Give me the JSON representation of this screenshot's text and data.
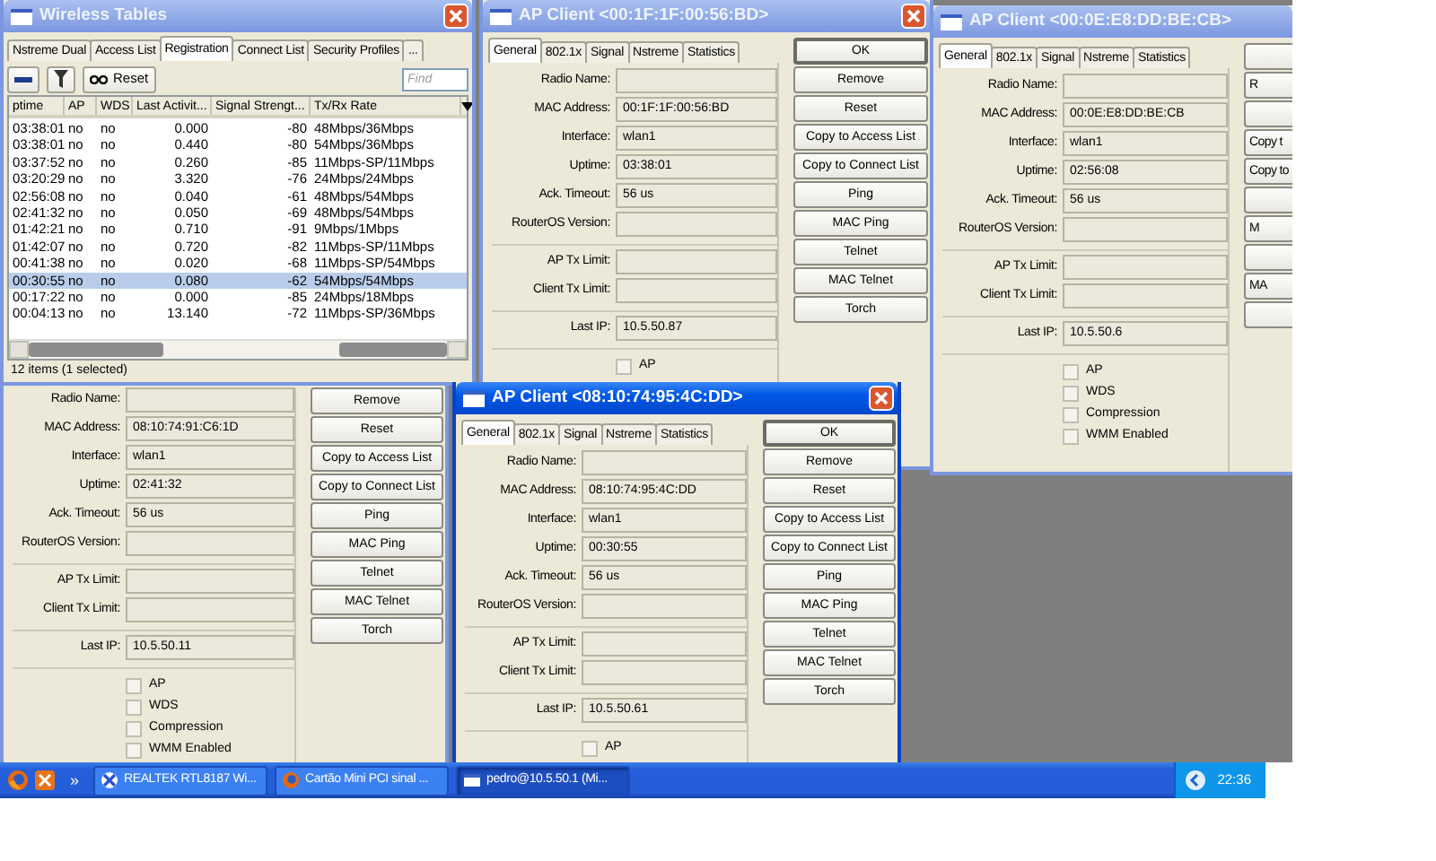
{
  "windows": [
    {
      "kind": "table",
      "title": "Wireless Tables",
      "active": false,
      "tabs": [
        {
          "label": "Nstreme Dual",
          "selected": false
        },
        {
          "label": "Access List",
          "selected": false
        },
        {
          "label": "Registration",
          "selected": true
        },
        {
          "label": "Connect List",
          "selected": false
        },
        {
          "label": "Security Profiles",
          "selected": false
        },
        {
          "label": "...",
          "selected": false
        }
      ],
      "toolbar": {
        "reset": "Reset",
        "find_placeholder": "Find"
      },
      "columns": [
        "ptime",
        "AP",
        "WDS",
        "Last Activit...",
        "Signal Strengt...",
        "Tx/Rx Rate"
      ],
      "rows": [
        {
          "cells": [
            "03:38:01",
            "no",
            "no",
            "0.000",
            "-80",
            "48Mbps/36Mbps"
          ],
          "selected": false
        },
        {
          "cells": [
            "03:38:01",
            "no",
            "no",
            "0.440",
            "-80",
            "54Mbps/36Mbps"
          ],
          "selected": false
        },
        {
          "cells": [
            "03:37:52",
            "no",
            "no",
            "0.260",
            "-85",
            "11Mbps-SP/11Mbps"
          ],
          "selected": false
        },
        {
          "cells": [
            "03:20:29",
            "no",
            "no",
            "3.320",
            "-76",
            "24Mbps/24Mbps"
          ],
          "selected": false
        },
        {
          "cells": [
            "02:56:08",
            "no",
            "no",
            "0.040",
            "-61",
            "48Mbps/54Mbps"
          ],
          "selected": false
        },
        {
          "cells": [
            "02:41:32",
            "no",
            "no",
            "0.050",
            "-69",
            "48Mbps/54Mbps"
          ],
          "selected": false
        },
        {
          "cells": [
            "01:42:21",
            "no",
            "no",
            "0.710",
            "-91",
            "9Mbps/1Mbps"
          ],
          "selected": false
        },
        {
          "cells": [
            "01:42:07",
            "no",
            "no",
            "0.720",
            "-82",
            "11Mbps-SP/11Mbps"
          ],
          "selected": false
        },
        {
          "cells": [
            "00:41:38",
            "no",
            "no",
            "0.020",
            "-68",
            "11Mbps-SP/54Mbps"
          ],
          "selected": false
        },
        {
          "cells": [
            "00:30:55",
            "no",
            "no",
            "0.080",
            "-62",
            "54Mbps/54Mbps"
          ],
          "selected": true
        },
        {
          "cells": [
            "00:17:22",
            "no",
            "no",
            "0.000",
            "-85",
            "24Mbps/18Mbps"
          ],
          "selected": false
        },
        {
          "cells": [
            "00:04:13",
            "no",
            "no",
            "13.140",
            "-72",
            "11Mbps-SP/36Mbps"
          ],
          "selected": false
        }
      ],
      "status": "12 items (1 selected)"
    },
    {
      "kind": "client",
      "title": "AP Client <00:1F:1F:00:56:BD>",
      "active": false,
      "tabs": [
        {
          "label": "General",
          "selected": true
        },
        {
          "label": "802.1x",
          "selected": false
        },
        {
          "label": "Signal",
          "selected": false
        },
        {
          "label": "Nstreme",
          "selected": false
        },
        {
          "label": "Statistics",
          "selected": false
        }
      ],
      "field_groups": [
        [
          {
            "label": "Radio Name:"
          },
          {
            "label": "MAC Address:",
            "value": "00:1F:1F:00:56:BD"
          },
          {
            "label": "Interface:",
            "value": "wlan1"
          },
          {
            "label": "Uptime:",
            "value": "03:38:01"
          },
          {
            "label": "Ack. Timeout:",
            "value": "56 us"
          },
          {
            "label": "RouterOS Version:"
          }
        ],
        [
          {
            "label": "AP Tx Limit:"
          },
          {
            "label": "Client Tx Limit:"
          }
        ],
        [
          {
            "label": "Last IP:",
            "value": "10.5.50.87"
          }
        ]
      ],
      "checkboxes": [
        {
          "label": "AP",
          "checked": false
        }
      ],
      "buttons": [
        {
          "kind": "default",
          "label": "OK"
        },
        {
          "kind": "label",
          "label": "Remove"
        },
        {
          "kind": "label",
          "label": "Reset"
        },
        {
          "kind": "label",
          "label": "Copy to Access List"
        },
        {
          "kind": "label",
          "label": "Copy to Connect List"
        },
        {
          "kind": "label",
          "label": "Ping"
        },
        {
          "kind": "label",
          "label": "MAC Ping"
        },
        {
          "kind": "label",
          "label": "Telnet"
        },
        {
          "kind": "label",
          "label": "MAC Telnet"
        },
        {
          "kind": "label",
          "label": "Torch"
        }
      ]
    },
    {
      "kind": "client",
      "title": "AP Client <00:0E:E8:DD:BE:CB>",
      "active": false,
      "tabs": [
        {
          "label": "General",
          "selected": true
        },
        {
          "label": "802.1x",
          "selected": false
        },
        {
          "label": "Signal",
          "selected": false
        },
        {
          "label": "Nstreme",
          "selected": false
        },
        {
          "label": "Statistics",
          "selected": false
        }
      ],
      "field_groups": [
        [
          {
            "label": "Radio Name:"
          },
          {
            "label": "MAC Address:",
            "value": "00:0E:E8:DD:BE:CB"
          },
          {
            "label": "Interface:",
            "value": "wlan1"
          },
          {
            "label": "Uptime:",
            "value": "02:56:08"
          },
          {
            "label": "Ack. Timeout:",
            "value": "56 us"
          },
          {
            "label": "RouterOS Version:"
          }
        ],
        [
          {
            "label": "AP Tx Limit:"
          },
          {
            "label": "Client Tx Limit:"
          }
        ],
        [
          {
            "label": "Last IP:",
            "value": "10.5.50.6"
          }
        ]
      ],
      "checkboxes": [
        {
          "label": "AP",
          "checked": false
        },
        {
          "label": "WDS",
          "checked": false
        },
        {
          "label": "Compression",
          "checked": false
        },
        {
          "label": "WMM Enabled",
          "checked": false
        }
      ],
      "buttons": [
        {
          "kind": "blank"
        },
        {
          "kind": "label",
          "label": "R"
        },
        {
          "kind": "blank"
        },
        {
          "kind": "label",
          "label": "Copy t"
        },
        {
          "kind": "label",
          "label": "Copy to"
        },
        {
          "kind": "blank"
        },
        {
          "kind": "label",
          "label": "M"
        },
        {
          "kind": "blank"
        },
        {
          "kind": "label",
          "label": "MA"
        },
        {
          "kind": "blank"
        }
      ]
    },
    {
      "kind": "client",
      "active": false,
      "field_groups": [
        [
          {
            "label": "Radio Name:"
          },
          {
            "label": "MAC Address:",
            "value": "08:10:74:91:C6:1D"
          },
          {
            "label": "Interface:",
            "value": "wlan1"
          },
          {
            "label": "Uptime:",
            "value": "02:41:32"
          },
          {
            "label": "Ack. Timeout:",
            "value": "56 us"
          },
          {
            "label": "RouterOS Version:"
          }
        ],
        [
          {
            "label": "AP Tx Limit:"
          },
          {
            "label": "Client Tx Limit:"
          }
        ],
        [
          {
            "label": "Last IP:",
            "value": "10.5.50.11"
          }
        ]
      ],
      "checkboxes": [
        {
          "label": "AP",
          "checked": false
        },
        {
          "label": "WDS",
          "checked": false
        },
        {
          "label": "Compression",
          "checked": false
        },
        {
          "label": "WMM Enabled",
          "checked": false
        }
      ],
      "buttons": [
        {
          "kind": "label",
          "label": "Remove"
        },
        {
          "kind": "label",
          "label": "Reset"
        },
        {
          "kind": "label",
          "label": "Copy to Access List"
        },
        {
          "kind": "label",
          "label": "Copy to Connect List"
        },
        {
          "kind": "label",
          "label": "Ping"
        },
        {
          "kind": "label",
          "label": "MAC Ping"
        },
        {
          "kind": "label",
          "label": "Telnet"
        },
        {
          "kind": "label",
          "label": "MAC Telnet"
        },
        {
          "kind": "label",
          "label": "Torch"
        }
      ]
    },
    {
      "kind": "client",
      "title": "AP Client <08:10:74:95:4C:DD>",
      "active": true,
      "tabs": [
        {
          "label": "General",
          "selected": true
        },
        {
          "label": "802.1x",
          "selected": false
        },
        {
          "label": "Signal",
          "selected": false
        },
        {
          "label": "Nstreme",
          "selected": false
        },
        {
          "label": "Statistics",
          "selected": false
        }
      ],
      "field_groups": [
        [
          {
            "label": "Radio Name:"
          },
          {
            "label": "MAC Address:",
            "value": "08:10:74:95:4C:DD"
          },
          {
            "label": "Interface:",
            "value": "wlan1"
          },
          {
            "label": "Uptime:",
            "value": "00:30:55"
          },
          {
            "label": "Ack. Timeout:",
            "value": "56 us"
          },
          {
            "label": "RouterOS Version:"
          }
        ],
        [
          {
            "label": "AP Tx Limit:"
          },
          {
            "label": "Client Tx Limit:"
          }
        ],
        [
          {
            "label": "Last IP:",
            "value": "10.5.50.61"
          }
        ]
      ],
      "checkboxes": [
        {
          "label": "AP",
          "checked": false
        }
      ],
      "buttons": [
        {
          "kind": "default",
          "label": "OK"
        },
        {
          "kind": "label",
          "label": "Remove"
        },
        {
          "kind": "label",
          "label": "Reset"
        },
        {
          "kind": "label",
          "label": "Copy to Access List"
        },
        {
          "kind": "label",
          "label": "Copy to Connect List"
        },
        {
          "kind": "label",
          "label": "Ping"
        },
        {
          "kind": "label",
          "label": "MAC Ping"
        },
        {
          "kind": "label",
          "label": "Telnet"
        },
        {
          "kind": "label",
          "label": "MAC Telnet"
        },
        {
          "kind": "label",
          "label": "Torch"
        }
      ]
    }
  ],
  "taskbar": {
    "overflow": "»",
    "tasks": [
      {
        "label": "REALTEK RTL8187 Wi...",
        "selected": false,
        "kind": "net"
      },
      {
        "label": "Cartão Mini PCI sinal ...",
        "selected": false,
        "kind": "browser"
      },
      {
        "label": "pedro@10.5.50.1 (Mi...",
        "selected": true,
        "kind": "terminal"
      }
    ],
    "clock": "22:36"
  }
}
